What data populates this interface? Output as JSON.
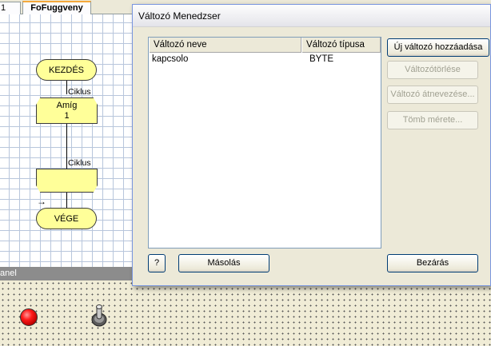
{
  "tabs": {
    "prev_label": "1",
    "active_label": "FoFuggveny"
  },
  "flowchart": {
    "start_label": "KEZDÉS",
    "loop_top_tag": "Ciklus",
    "loop_top_line1": "Amíg",
    "loop_top_line2": "1",
    "loop_bottom_tag": "Ciklus",
    "end_label": "VÉGE",
    "entry_arrow": "→",
    "colors": {
      "block_fill": "#ffff99",
      "grid": "#b8c6dc"
    }
  },
  "panel": {
    "title": "anel",
    "led_color": "#ff1a1a",
    "icons": [
      "led-icon",
      "toggle-switch-icon"
    ]
  },
  "dialog": {
    "title": "Változó Menedzser",
    "columns": [
      "Változó neve",
      "Változó típusa"
    ],
    "rows": [
      {
        "name": "kapcsolo",
        "type": "BYTE"
      }
    ],
    "buttons": {
      "new_variable": "Új változó hozzáadása",
      "delete_variable": "Változótörlése",
      "rename_variable": "Változó átnevezése...",
      "array_size": "Tömb mérete...",
      "help": "?",
      "copy": "Másolás",
      "close": "Bezárás"
    }
  }
}
